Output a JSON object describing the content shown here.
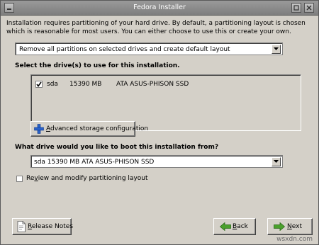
{
  "window": {
    "title": "Fedora Installer"
  },
  "intro": {
    "text": "Installation requires partitioning of your hard drive.  By default, a partitioning layout is chosen which is reasonable for most users.  You can either choose to use this or create your own."
  },
  "layout_select": {
    "value": "Remove all partitions on selected drives and create default layout"
  },
  "drives": {
    "label": "Select the drive(s) to use for this installation.",
    "items": [
      {
        "checked": true,
        "name": "sda",
        "size": "15390 MB",
        "model": "ATA ASUS-PHISON SSD"
      }
    ]
  },
  "advanced_button": {
    "label_underlined": "A",
    "label_rest": "dvanced storage configuration"
  },
  "boot": {
    "label": "What drive would you like to boot this installation from?",
    "value": "sda    15390 MB ATA ASUS-PHISON SSD"
  },
  "review": {
    "checked": false,
    "label_pre": "Re",
    "label_underlined": "v",
    "label_post": "iew and modify partitioning layout"
  },
  "footer": {
    "release_notes_pre": "",
    "release_notes_underlined": "R",
    "release_notes_post": "elease Notes",
    "back_underlined": "B",
    "back_post": "ack",
    "next_underlined": "N",
    "next_post": "ext"
  },
  "watermark": "wsxdn.com",
  "colors": {
    "window_bg": "#d4d0c8",
    "titlebar": "#8a8a8a",
    "arrow_green": "#4aa02c",
    "plus_blue": "#2a62c9"
  },
  "icons": [
    "minimize-icon",
    "maximize-icon",
    "close-icon",
    "checkmark-icon",
    "plus-icon",
    "document-icon",
    "back-arrow-icon",
    "next-arrow-icon",
    "dropdown-arrow-icon"
  ]
}
